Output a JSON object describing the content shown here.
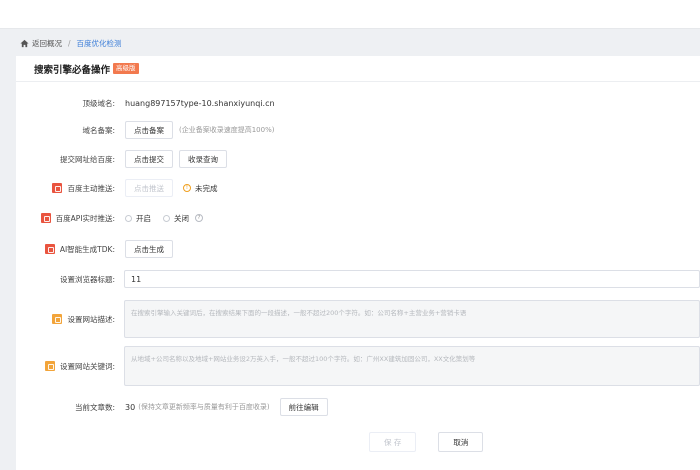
{
  "breadcrumb": {
    "back": "返回概况",
    "separator": "/",
    "current": "百度优化检测"
  },
  "card": {
    "title": "搜索引擎必备操作",
    "badge": "高级版"
  },
  "rows": {
    "domain": {
      "label": "顶级域名:",
      "value": "huang897157type-10.shanxiyunqi.cn"
    },
    "record": {
      "label": "域名备案:",
      "button": "点击备案",
      "hint": "(企业备案收录速度提高100%)"
    },
    "submit": {
      "label": "提交网址给百度:",
      "button1": "点击提交",
      "button2": "收录查询"
    },
    "push": {
      "label": "百度主动推送:",
      "button": "点击推送",
      "status": "未完成"
    },
    "api": {
      "label": "百度API实时推送:",
      "opt_on": "开启",
      "opt_off": "关闭"
    },
    "tdk": {
      "label": "AI智能生成TDK:",
      "button": "点击生成"
    },
    "title": {
      "label": "设置浏览器标题:",
      "value": "11"
    },
    "desc": {
      "label": "设置网站描述:",
      "placeholder": "在搜索引擎输入关键词后，在搜索结果下面的一段描述，一般不超过200个字符。如：公司名称+主营业务+营销卡语"
    },
    "keywords": {
      "label": "设置网站关键词:",
      "placeholder": "从地域+公司名称以及地域+网站业务设2万英入手，一般不超过100个字符。如：广州XX建筑加固公司，XX文化策划等"
    },
    "articles": {
      "label": "当前文章数:",
      "count": "30",
      "hint": "(保持文章更新频率与质量有利于百度收录)",
      "button": "前往编辑"
    }
  },
  "footer": {
    "save": "保 存",
    "cancel": "取消"
  },
  "colors": {
    "accent": "#3b7dd8",
    "red_icon": "#e9543f",
    "orange_icon": "#f2a43a",
    "badge": "#f2794e"
  }
}
